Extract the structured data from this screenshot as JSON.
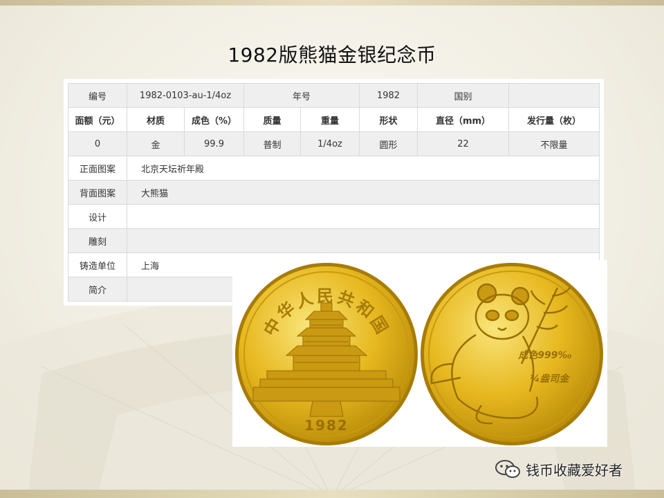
{
  "title": "1982版熊猫金银纪念币",
  "spec_table": {
    "row1": {
      "label_no": "编号",
      "value_no": "1982-0103-au-1/4oz",
      "label_year": "年号",
      "value_year": "1982",
      "label_country": "国别",
      "value_country": ""
    },
    "headers": [
      "面额（元）",
      "材质",
      "成色（%）",
      "质量",
      "重量",
      "形状",
      "直径（mm）",
      "发行量（枚）"
    ],
    "values": [
      "0",
      "金",
      "99.9",
      "普制",
      "1/4oz",
      "圆形",
      "22",
      "不限量"
    ],
    "details": [
      {
        "label": "正面图案",
        "value": "北京天坛祈年殿"
      },
      {
        "label": "背面图案",
        "value": "大熊猫"
      },
      {
        "label": "设计",
        "value": ""
      },
      {
        "label": "雕刻",
        "value": ""
      },
      {
        "label": "铸造单位",
        "value": "上海"
      },
      {
        "label": "简介",
        "value": ""
      }
    ]
  },
  "coins": {
    "obverse": {
      "legend": "中华人民共和国",
      "year": "1982"
    },
    "reverse": {
      "purity": "成色999‰",
      "weight": "¼盎司金"
    }
  },
  "watermark": {
    "text": "钱币收藏爱好者"
  },
  "colors": {
    "gold": "#e3b21c",
    "gold_dark": "#9a6f05",
    "gold_light": "#f6dc63"
  }
}
